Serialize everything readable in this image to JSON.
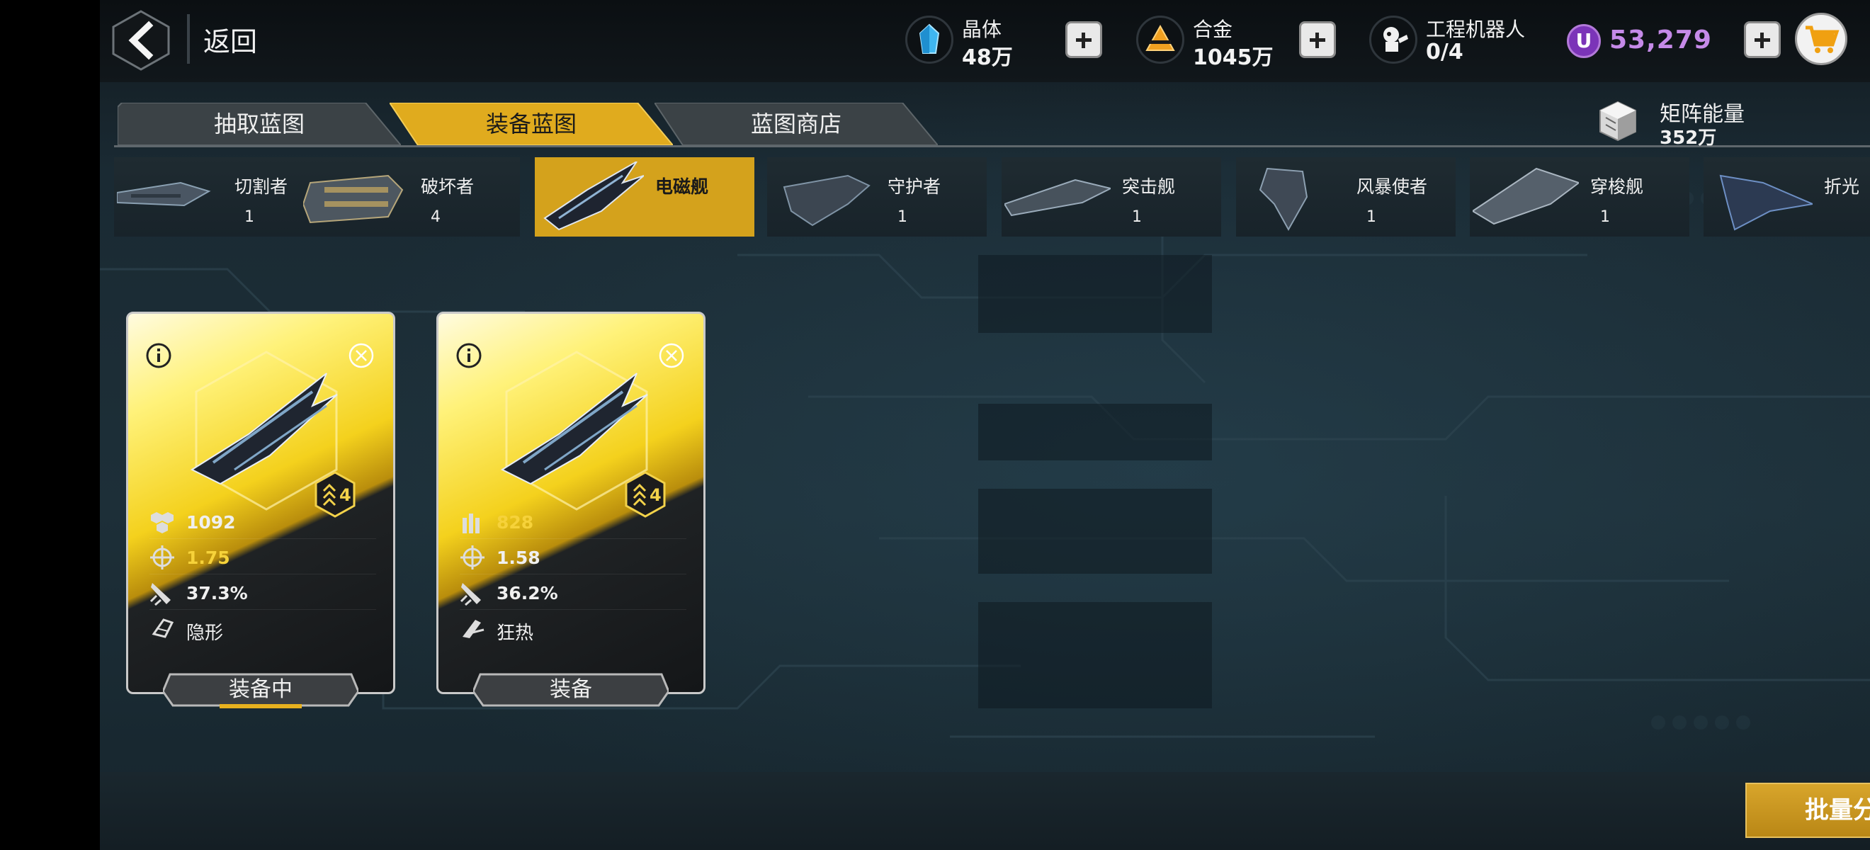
{
  "header": {
    "back_label": "返回",
    "resources": [
      {
        "name": "晶体",
        "value": "48万",
        "icon": "crystal-icon"
      },
      {
        "name": "合金",
        "value": "1045万",
        "icon": "alloy-icon"
      },
      {
        "name": "工程机器人",
        "value": "0/4",
        "icon": "robot-icon"
      }
    ],
    "premium": {
      "badge": "U",
      "value": "53,279",
      "color": "#c58ae8"
    }
  },
  "tabs": [
    {
      "label": "抽取蓝图",
      "active": false
    },
    {
      "label": "装备蓝图",
      "active": true
    },
    {
      "label": "蓝图商店",
      "active": false
    }
  ],
  "matrix_energy": {
    "name": "矩阵能量",
    "value": "352万"
  },
  "ships": [
    {
      "name": "切割者",
      "count": "1"
    },
    {
      "name": "破坏者",
      "count": "4"
    },
    {
      "name": "电磁舰",
      "count": "",
      "selected": true
    },
    {
      "name": "守护者",
      "count": "1"
    },
    {
      "name": "突击舰",
      "count": "1"
    },
    {
      "name": "风暴使者",
      "count": "1"
    },
    {
      "name": "穿梭舰",
      "count": "1"
    },
    {
      "name": "折光",
      "count": ""
    }
  ],
  "cards": [
    {
      "rank": "4",
      "stats": [
        {
          "icon": "cluster-icon",
          "value": "1092",
          "highlight": false
        },
        {
          "icon": "crosshair-icon",
          "value": "1.75",
          "highlight": true
        },
        {
          "icon": "missile-icon",
          "value": "37.3%",
          "highlight": false
        }
      ],
      "trait": {
        "icon": "stealth-icon",
        "label": "隐形"
      },
      "button": "装备中"
    },
    {
      "rank": "4",
      "stats": [
        {
          "icon": "ammo-icon",
          "value": "828",
          "highlight": true
        },
        {
          "icon": "crosshair-icon",
          "value": "1.58",
          "highlight": false
        },
        {
          "icon": "missile-icon",
          "value": "36.2%",
          "highlight": false
        }
      ],
      "trait": {
        "icon": "frenzy-icon",
        "label": "狂热"
      },
      "button": "装备"
    }
  ],
  "footer": {
    "batch_label": "批量分解"
  },
  "colors": {
    "gold": "#d4a21c",
    "panel": "#1f2b31",
    "purple": "#c58ae8"
  }
}
